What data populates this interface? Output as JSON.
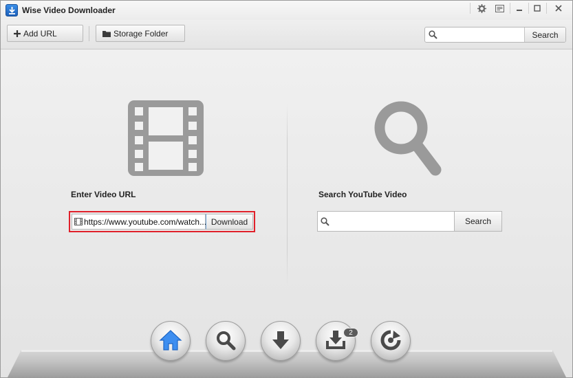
{
  "window": {
    "title": "Wise Video Downloader",
    "controls": [
      "settings-icon",
      "feedback-icon",
      "minimize-icon",
      "maximize-icon",
      "close-icon"
    ]
  },
  "toolbar": {
    "add_url_label": "Add URL",
    "storage_folder_label": "Storage Folder",
    "search_value": "",
    "search_button_label": "Search"
  },
  "left_panel": {
    "label": "Enter Video URL",
    "url_value": "https://www.youtube.com/watch...",
    "download_button_label": "Download",
    "highlight_color": "#e0202a"
  },
  "right_panel": {
    "label": "Search YouTube Video",
    "search_value": "",
    "search_button_label": "Search"
  },
  "dock": {
    "items": [
      "home-icon",
      "search-icon",
      "download-icon",
      "downloaded-icon",
      "convert-icon"
    ],
    "active_item": "home-icon",
    "downloaded_count": "2",
    "accent_color": "#3d8ef0"
  }
}
